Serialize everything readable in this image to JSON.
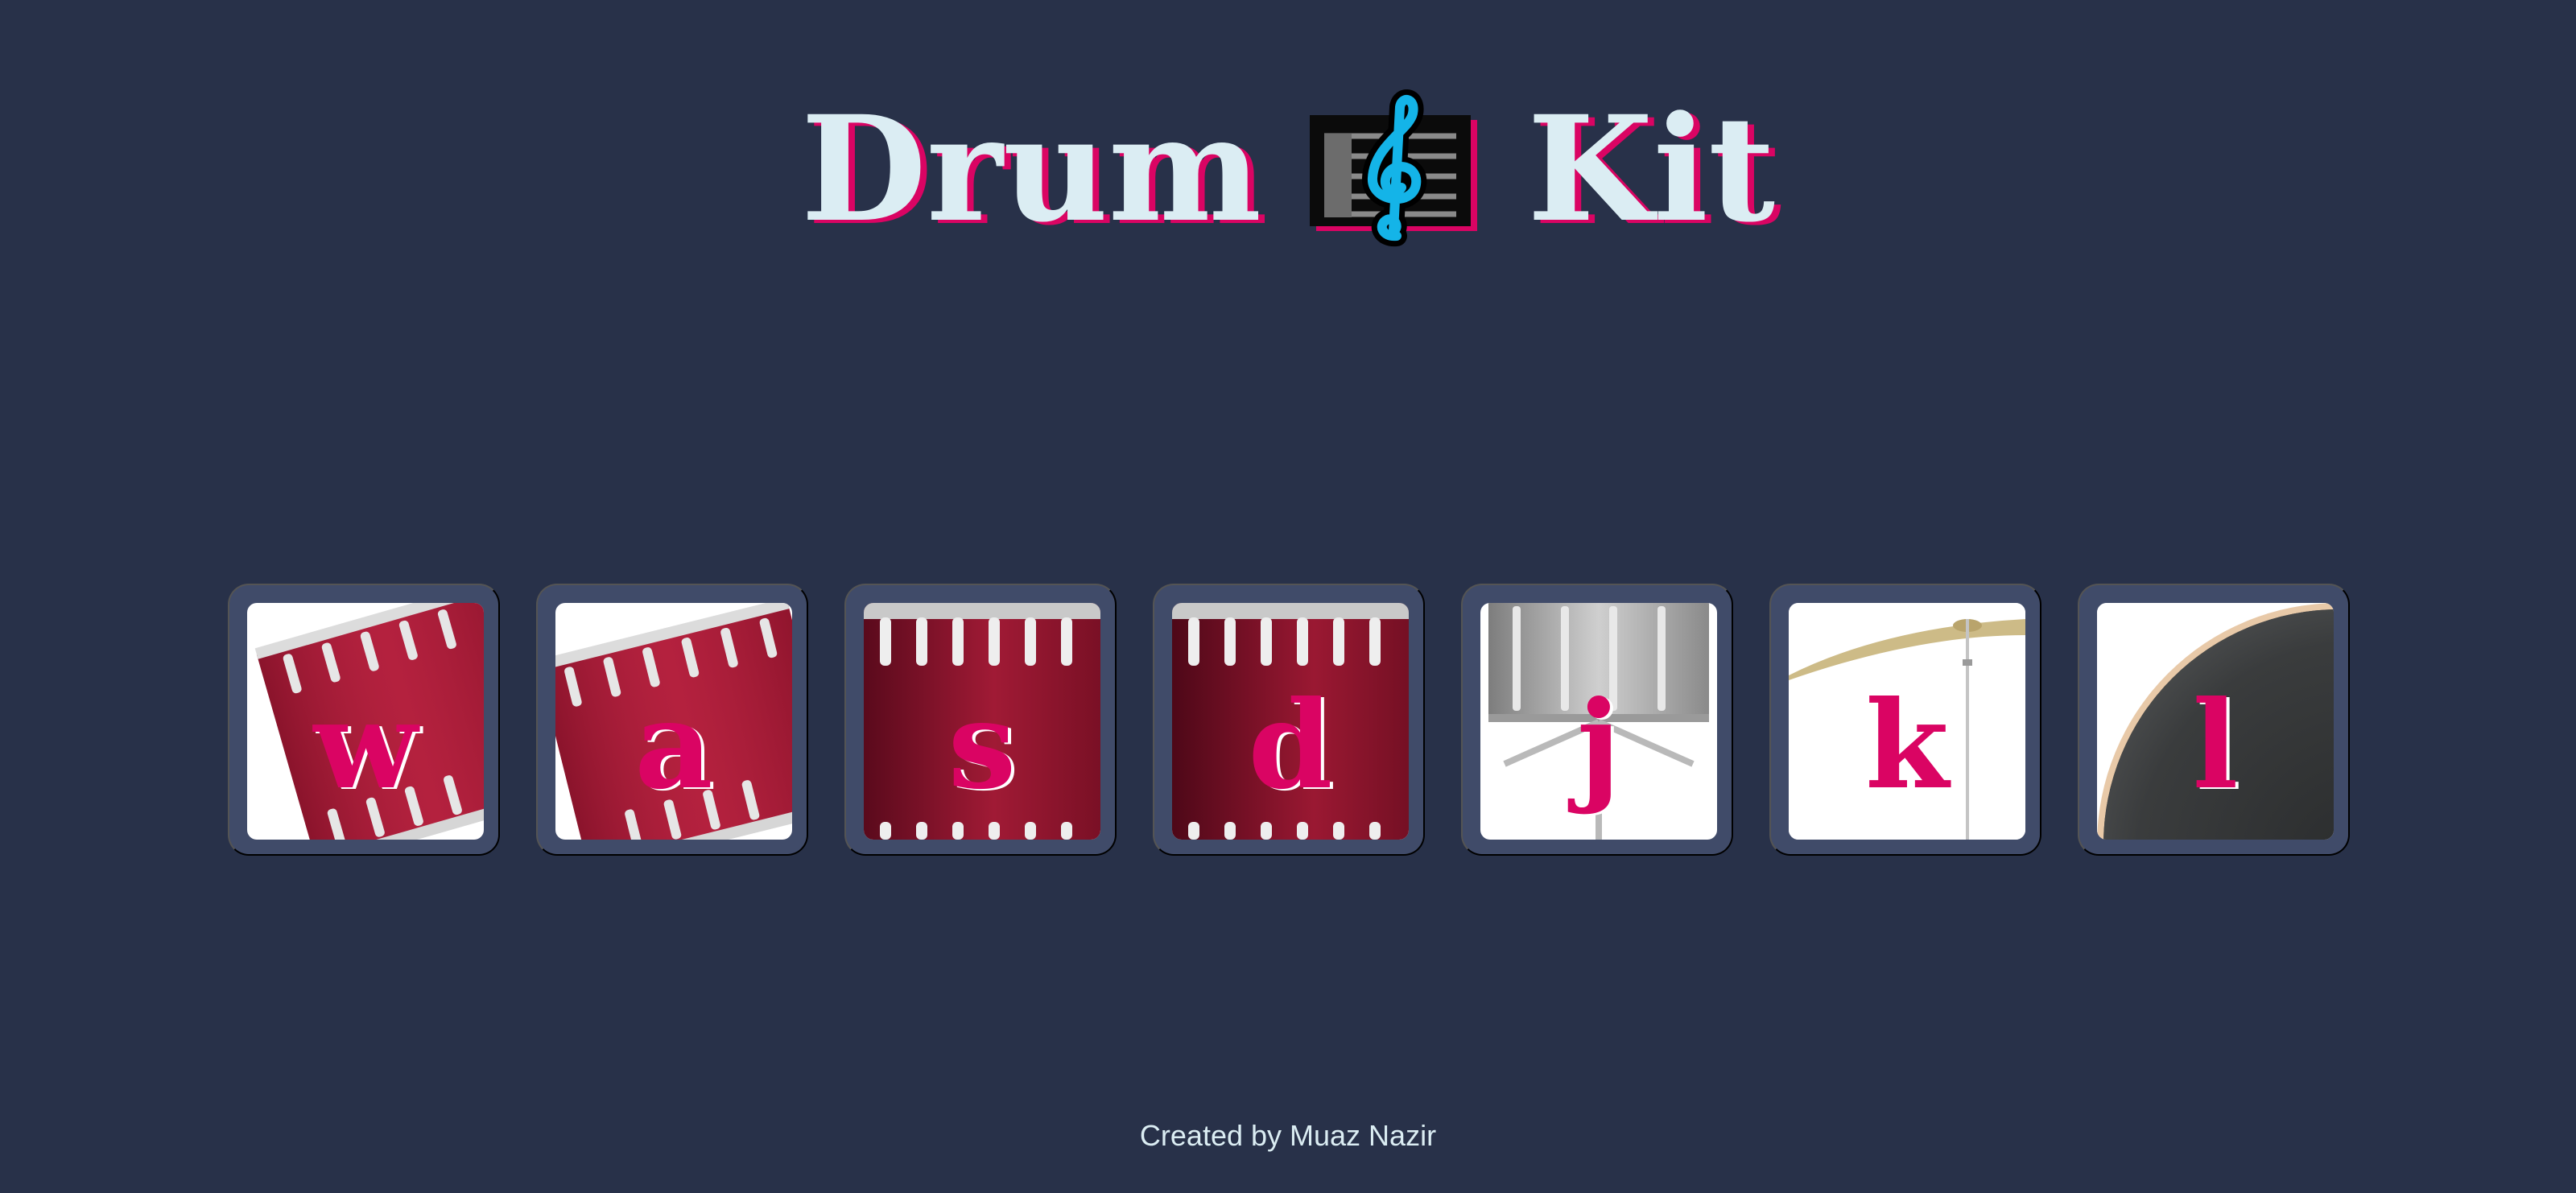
{
  "header": {
    "title_left": "Drum",
    "title_right": "Kit",
    "logo_icon": "treble-clef-icon"
  },
  "drums": [
    {
      "key": "w",
      "image": "tom-1-icon"
    },
    {
      "key": "a",
      "image": "tom-2-icon"
    },
    {
      "key": "s",
      "image": "tom-3-icon"
    },
    {
      "key": "d",
      "image": "tom-4-icon"
    },
    {
      "key": "j",
      "image": "snare-icon"
    },
    {
      "key": "k",
      "image": "crash-cymbal-icon"
    },
    {
      "key": "l",
      "image": "kick-drum-icon"
    }
  ],
  "footer": {
    "text": "Created by Muaz Nazir"
  },
  "colors": {
    "background": "#283149",
    "tile": "#404b69",
    "accent": "#da0463",
    "text": "#dbedf3"
  }
}
